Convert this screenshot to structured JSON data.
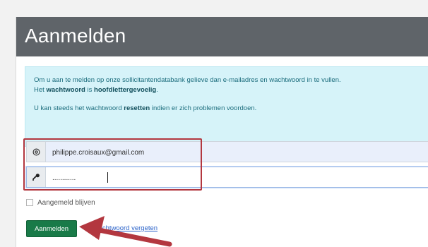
{
  "header": {
    "title": "Aanmelden"
  },
  "info": {
    "line1_before": "Om u aan te melden op onze sollicitantendatabank gelieve dan e-mailadres en wachtwoord in te vullen.",
    "line1_prefix": "Het",
    "line1_bold1": "wachtwoord",
    "line1_mid": "is",
    "line1_bold2": "hoofdlettergevoelig",
    "line1_end": ".",
    "line2_before": "U kan steeds het wachtwoord",
    "line2_bold": "resetten",
    "line2_after": "indien er zich problemen voordoen."
  },
  "form": {
    "email_icon": "at-icon",
    "email_value": "philippe.croisaux@gmail.com",
    "password_icon": "key-icon",
    "password_value": "............",
    "remember_label": "Aangemeld blijven",
    "submit_label": "Aanmelden",
    "forgot_label": "Wachtwoord vergeten"
  },
  "annotation": {
    "highlight_color": "#b3373f",
    "arrow_color": "#b3373f"
  }
}
